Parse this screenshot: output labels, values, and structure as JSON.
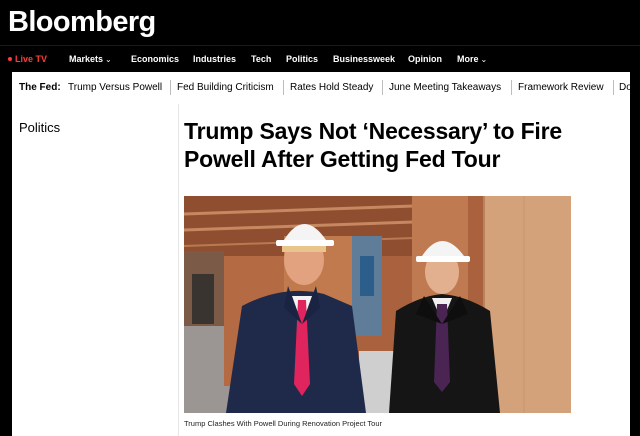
{
  "brand": "Bloomberg",
  "nav": {
    "live_label": "Live TV",
    "items": [
      "Markets",
      "Economics",
      "Industries",
      "Tech",
      "Politics",
      "Businessweek",
      "Opinion",
      "More"
    ]
  },
  "topic_bar": {
    "lead": "The Fed:",
    "items": [
      "Trump Versus Powell",
      "Fed Building Criticism",
      "Rates Hold Steady",
      "June Meeting Takeaways",
      "Framework Review",
      "Dot P"
    ]
  },
  "article": {
    "section": "Politics",
    "headline_line1": "Trump Says Not ‘Necessary’ to Fire",
    "headline_line2": "Powell After Getting Fed Tour",
    "caption": "Trump Clashes With Powell During Renovation Project Tour"
  },
  "colors": {
    "live": "#ff3b3b",
    "masthead": "#000000"
  }
}
